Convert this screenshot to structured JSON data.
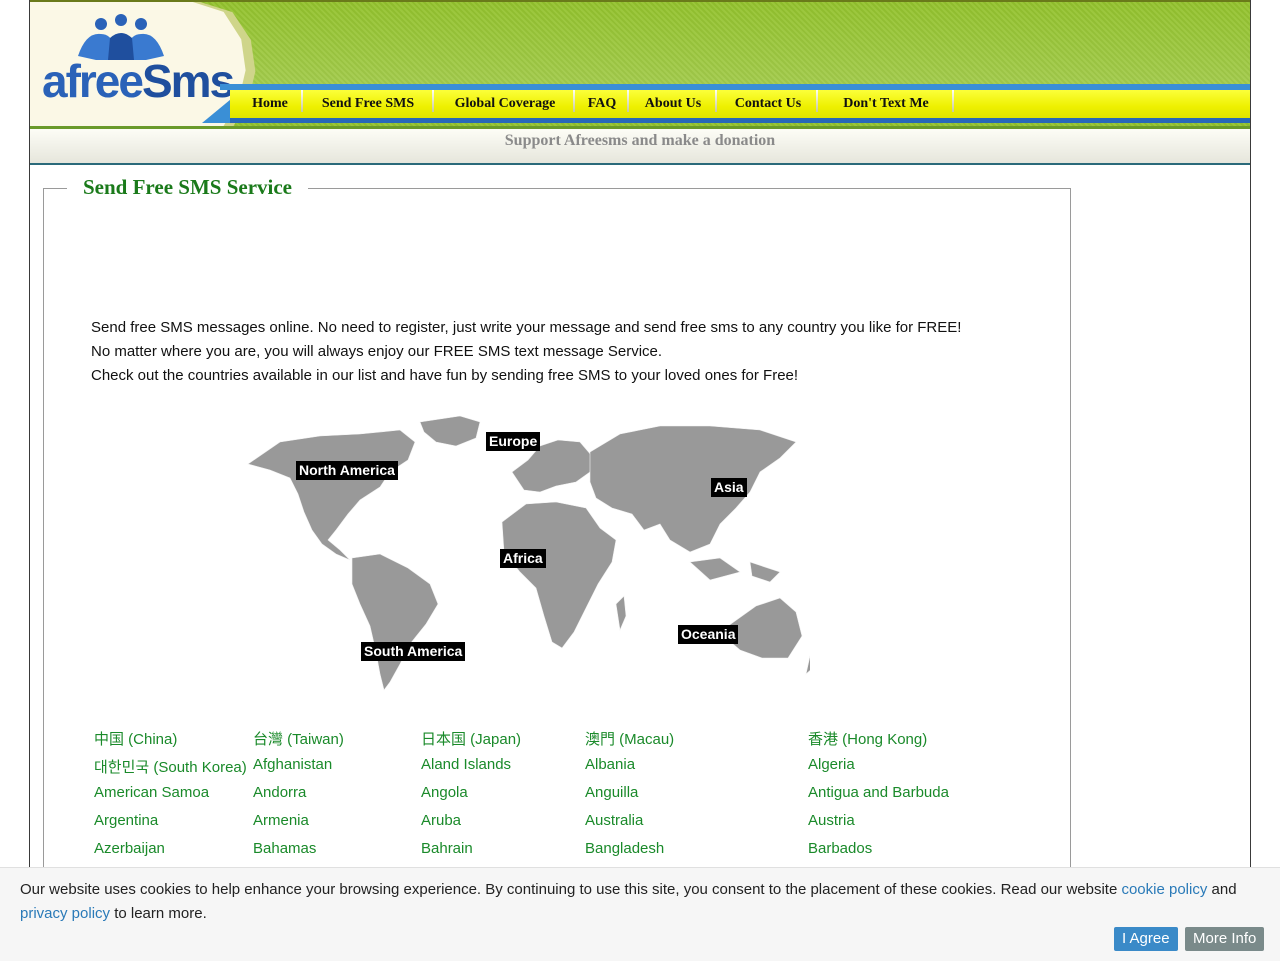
{
  "header": {
    "logo_text_a": "afree",
    "logo_text_b": "Sms",
    "nav": [
      "Home",
      "Send Free SMS",
      "Global Coverage",
      "FAQ",
      "About Us",
      "Contact Us",
      "Don't Text Me"
    ],
    "donation": "Support Afreesms and make a donation"
  },
  "main": {
    "legend": "Send Free SMS Service",
    "intro": [
      "Send free SMS messages online. No need to register, just write your message and send free sms to any country you like for FREE!",
      "No matter where you are, you will always enjoy our FREE SMS text message Service.",
      "Check out the countries available in our list and have fun by sending free SMS to your loved ones for Free!"
    ],
    "continents": [
      "North America",
      "Europe",
      "Asia",
      "Africa",
      "Oceania",
      "South America"
    ],
    "countries": [
      [
        "中国 (China)",
        "台灣 (Taiwan)",
        "日本国 (Japan)",
        "澳門 (Macau)",
        "香港 (Hong Kong)"
      ],
      [
        "대한민국 (South Korea)",
        "Afghanistan",
        "Aland Islands",
        "Albania",
        "Algeria"
      ],
      [
        "American Samoa",
        "Andorra",
        "Angola",
        "Anguilla",
        "Antigua and Barbuda"
      ],
      [
        "Argentina",
        "Armenia",
        "Aruba",
        "Australia",
        "Austria"
      ],
      [
        "Azerbaijan",
        "Bahamas",
        "Bahrain",
        "Bangladesh",
        "Barbados"
      ]
    ]
  },
  "cookie": {
    "text_before": "Our website uses cookies to help enhance your browsing experience. By continuing to use this site, you consent to the placement of these cookies. Read our website ",
    "cookie_policy": "cookie policy",
    "and": " and ",
    "privacy_policy": "privacy policy",
    "text_after": " to learn more.",
    "agree_button": "I Agree",
    "more_button": "More Info"
  },
  "colors": {
    "nav_yellow": "#eef000",
    "header_green": "#8ebc2c",
    "link_green": "#1a8a2a",
    "legend_green": "#1a7a1a",
    "agree_blue": "#3a8ac8",
    "more_gray": "#7a8a8a"
  }
}
